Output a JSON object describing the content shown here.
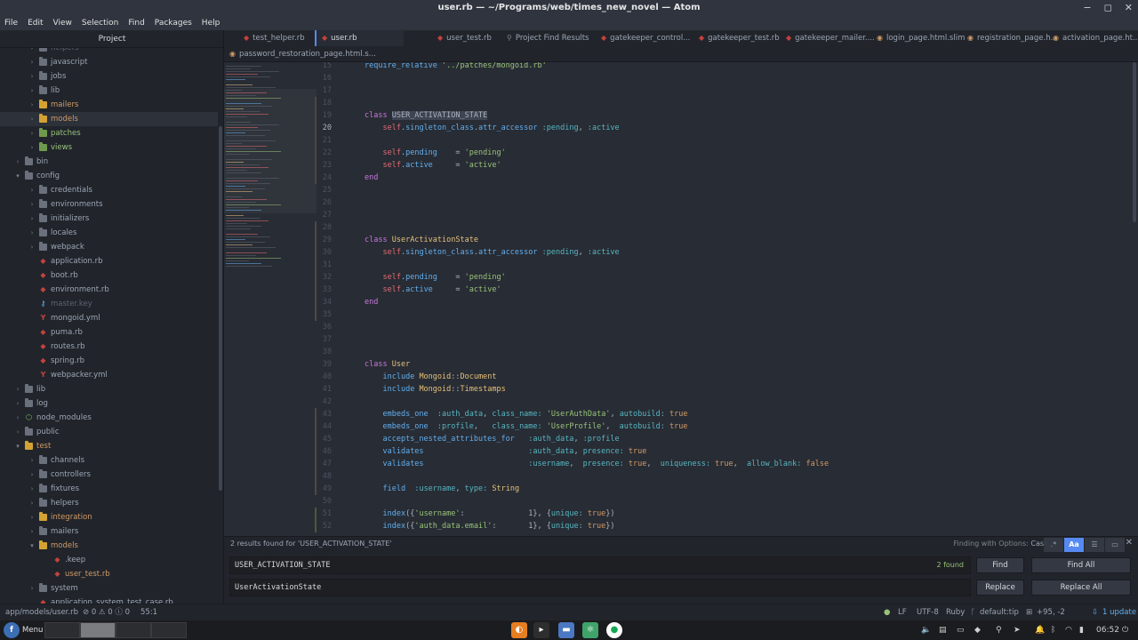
{
  "window": {
    "title": "user.rb — ~/Programs/web/times_new_novel — Atom",
    "controls": [
      "−",
      "◻",
      "✕"
    ]
  },
  "menu": [
    "File",
    "Edit",
    "View",
    "Selection",
    "Find",
    "Packages",
    "Help"
  ],
  "tree": {
    "header": "Project",
    "rows": [
      {
        "label": "helpers",
        "type": "folder",
        "indent": 1,
        "expanded": false,
        "color": "muted"
      },
      {
        "label": "javascript",
        "type": "folder",
        "indent": 1,
        "expanded": false
      },
      {
        "label": "jobs",
        "type": "folder",
        "indent": 1,
        "expanded": false
      },
      {
        "label": "lib",
        "type": "folder",
        "indent": 1,
        "expanded": false
      },
      {
        "label": "mailers",
        "type": "folder",
        "indent": 1,
        "expanded": false,
        "color": "yellow"
      },
      {
        "label": "models",
        "type": "folder",
        "indent": 1,
        "expanded": false,
        "color": "yellow",
        "selected": true
      },
      {
        "label": "patches",
        "type": "folder",
        "indent": 1,
        "expanded": false,
        "color": "green"
      },
      {
        "label": "views",
        "type": "folder",
        "indent": 1,
        "expanded": false,
        "color": "green"
      },
      {
        "label": "bin",
        "type": "folder",
        "indent": 0,
        "expanded": false
      },
      {
        "label": "config",
        "type": "folder",
        "indent": 0,
        "expanded": true
      },
      {
        "label": "credentials",
        "type": "folder",
        "indent": 1,
        "expanded": false
      },
      {
        "label": "environments",
        "type": "folder",
        "indent": 1,
        "expanded": false
      },
      {
        "label": "initializers",
        "type": "folder",
        "indent": 1,
        "expanded": false
      },
      {
        "label": "locales",
        "type": "folder",
        "indent": 1,
        "expanded": false
      },
      {
        "label": "webpack",
        "type": "folder",
        "indent": 1,
        "expanded": false
      },
      {
        "label": "application.rb",
        "type": "ruby",
        "indent": 1
      },
      {
        "label": "boot.rb",
        "type": "ruby",
        "indent": 1
      },
      {
        "label": "environment.rb",
        "type": "ruby",
        "indent": 1
      },
      {
        "label": "master.key",
        "type": "key",
        "indent": 1,
        "color": "muted"
      },
      {
        "label": "mongoid.yml",
        "type": "yml",
        "indent": 1
      },
      {
        "label": "puma.rb",
        "type": "ruby",
        "indent": 1
      },
      {
        "label": "routes.rb",
        "type": "ruby",
        "indent": 1
      },
      {
        "label": "spring.rb",
        "type": "ruby",
        "indent": 1
      },
      {
        "label": "webpacker.yml",
        "type": "yml",
        "indent": 1
      },
      {
        "label": "lib",
        "type": "folder",
        "indent": 0,
        "expanded": false
      },
      {
        "label": "log",
        "type": "folder",
        "indent": 0,
        "expanded": false
      },
      {
        "label": "node_modules",
        "type": "node",
        "indent": 0,
        "expanded": false
      },
      {
        "label": "public",
        "type": "folder",
        "indent": 0,
        "expanded": false
      },
      {
        "label": "test",
        "type": "folder",
        "indent": 0,
        "expanded": true,
        "color": "yellow"
      },
      {
        "label": "channels",
        "type": "folder",
        "indent": 1,
        "expanded": false
      },
      {
        "label": "controllers",
        "type": "folder",
        "indent": 1,
        "expanded": false
      },
      {
        "label": "fixtures",
        "type": "folder",
        "indent": 1,
        "expanded": false
      },
      {
        "label": "helpers",
        "type": "folder",
        "indent": 1,
        "expanded": false
      },
      {
        "label": "integration",
        "type": "folder",
        "indent": 1,
        "expanded": false,
        "color": "yellow"
      },
      {
        "label": "mailers",
        "type": "folder",
        "indent": 1,
        "expanded": false
      },
      {
        "label": "models",
        "type": "folder",
        "indent": 1,
        "expanded": true,
        "color": "yellow"
      },
      {
        "label": ".keep",
        "type": "ruby",
        "indent": 2
      },
      {
        "label": "user_test.rb",
        "type": "ruby",
        "indent": 2,
        "color": "yellow"
      },
      {
        "label": "system",
        "type": "folder",
        "indent": 1,
        "expanded": false
      },
      {
        "label": "application_system_test_case.rb",
        "type": "ruby",
        "indent": 1
      }
    ]
  },
  "tabs": [
    {
      "label": "test_helper.rb",
      "icon": "ruby"
    },
    {
      "label": "user.rb",
      "icon": "ruby",
      "active": true
    },
    {
      "label": "user_test.rb",
      "icon": "ruby"
    },
    {
      "label": "Project Find Results",
      "icon": "search"
    },
    {
      "label": "gatekeeper_control...",
      "icon": "ruby"
    },
    {
      "label": "gatekeeper_test.rb",
      "icon": "ruby"
    },
    {
      "label": "gatekeeper_mailer....",
      "icon": "ruby"
    },
    {
      "label": "login_page.html.slim",
      "icon": "slim"
    },
    {
      "label": "registration_page.h...",
      "icon": "slim"
    },
    {
      "label": "activation_page.ht...",
      "icon": "slim"
    },
    {
      "label": "password_restoration_page.html.s...",
      "icon": "slim"
    }
  ],
  "editor": {
    "first_line": 15,
    "current_line": 20,
    "lines": [
      [
        [
          "meth",
          "require_relative"
        ],
        [
          "txt",
          " "
        ],
        [
          "str",
          "'../patches/mongoid.rb'"
        ]
      ],
      [],
      [],
      [],
      [
        [
          "kw",
          "class"
        ],
        [
          "txt",
          " "
        ],
        [
          "hl",
          "USER_ACTIVATION_STATE"
        ]
      ],
      [
        [
          "txt",
          "    "
        ],
        [
          "self",
          "self"
        ],
        [
          "txt",
          "."
        ],
        [
          "meth",
          "singleton_class"
        ],
        [
          "txt",
          "."
        ],
        [
          "meth",
          "attr_accessor"
        ],
        [
          "txt",
          " "
        ],
        [
          "sym",
          ":pending"
        ],
        [
          "txt",
          ", "
        ],
        [
          "sym",
          ":active"
        ]
      ],
      [],
      [
        [
          "txt",
          "    "
        ],
        [
          "self",
          "self"
        ],
        [
          "txt",
          "."
        ],
        [
          "meth",
          "pending"
        ],
        [
          "txt",
          "    = "
        ],
        [
          "str",
          "'pending'"
        ]
      ],
      [
        [
          "txt",
          "    "
        ],
        [
          "self",
          "self"
        ],
        [
          "txt",
          "."
        ],
        [
          "meth",
          "active"
        ],
        [
          "txt",
          "     = "
        ],
        [
          "str",
          "'active'"
        ]
      ],
      [
        [
          "kw",
          "end"
        ]
      ],
      [],
      [],
      [],
      [],
      [
        [
          "kw",
          "class"
        ],
        [
          "txt",
          " "
        ],
        [
          "cls",
          "UserActivationState"
        ]
      ],
      [
        [
          "txt",
          "    "
        ],
        [
          "self",
          "self"
        ],
        [
          "txt",
          "."
        ],
        [
          "meth",
          "singleton_class"
        ],
        [
          "txt",
          "."
        ],
        [
          "meth",
          "attr_accessor"
        ],
        [
          "txt",
          " "
        ],
        [
          "sym",
          ":pending"
        ],
        [
          "txt",
          ", "
        ],
        [
          "sym",
          ":active"
        ]
      ],
      [],
      [
        [
          "txt",
          "    "
        ],
        [
          "self",
          "self"
        ],
        [
          "txt",
          "."
        ],
        [
          "meth",
          "pending"
        ],
        [
          "txt",
          "    = "
        ],
        [
          "str",
          "'pending'"
        ]
      ],
      [
        [
          "txt",
          "    "
        ],
        [
          "self",
          "self"
        ],
        [
          "txt",
          "."
        ],
        [
          "meth",
          "active"
        ],
        [
          "txt",
          "     = "
        ],
        [
          "str",
          "'active'"
        ]
      ],
      [
        [
          "kw",
          "end"
        ]
      ],
      [],
      [],
      [],
      [],
      [
        [
          "kw",
          "class"
        ],
        [
          "txt",
          " "
        ],
        [
          "cls",
          "User"
        ]
      ],
      [
        [
          "txt",
          "    "
        ],
        [
          "meth",
          "include"
        ],
        [
          "txt",
          " "
        ],
        [
          "cls",
          "Mongoid"
        ],
        [
          "txt",
          "::"
        ],
        [
          "cls",
          "Document"
        ]
      ],
      [
        [
          "txt",
          "    "
        ],
        [
          "meth",
          "include"
        ],
        [
          "txt",
          " "
        ],
        [
          "cls",
          "Mongoid"
        ],
        [
          "txt",
          "::"
        ],
        [
          "cls",
          "Timestamps"
        ]
      ],
      [],
      [
        [
          "txt",
          "    "
        ],
        [
          "meth",
          "embeds_one"
        ],
        [
          "txt",
          "  "
        ],
        [
          "sym",
          ":auth_data"
        ],
        [
          "txt",
          ", "
        ],
        [
          "sym",
          "class_name:"
        ],
        [
          "txt",
          " "
        ],
        [
          "str",
          "'UserAuthData'"
        ],
        [
          "txt",
          ", "
        ],
        [
          "sym",
          "autobuild:"
        ],
        [
          "txt",
          " "
        ],
        [
          "const",
          "true"
        ]
      ],
      [
        [
          "txt",
          "    "
        ],
        [
          "meth",
          "embeds_one"
        ],
        [
          "txt",
          "  "
        ],
        [
          "sym",
          ":profile"
        ],
        [
          "txt",
          ",   "
        ],
        [
          "sym",
          "class_name:"
        ],
        [
          "txt",
          " "
        ],
        [
          "str",
          "'UserProfile'"
        ],
        [
          "txt",
          ",  "
        ],
        [
          "sym",
          "autobuild:"
        ],
        [
          "txt",
          " "
        ],
        [
          "const",
          "true"
        ]
      ],
      [
        [
          "txt",
          "    "
        ],
        [
          "meth",
          "accepts_nested_attributes_for"
        ],
        [
          "txt",
          "   "
        ],
        [
          "sym",
          ":auth_data"
        ],
        [
          "txt",
          ", "
        ],
        [
          "sym",
          ":profile"
        ]
      ],
      [
        [
          "txt",
          "    "
        ],
        [
          "meth",
          "validates"
        ],
        [
          "txt",
          "                       "
        ],
        [
          "sym",
          ":auth_data"
        ],
        [
          "txt",
          ", "
        ],
        [
          "sym",
          "presence:"
        ],
        [
          "txt",
          " "
        ],
        [
          "const",
          "true"
        ]
      ],
      [
        [
          "txt",
          "    "
        ],
        [
          "meth",
          "validates"
        ],
        [
          "txt",
          "                       "
        ],
        [
          "sym",
          ":username"
        ],
        [
          "txt",
          ",  "
        ],
        [
          "sym",
          "presence:"
        ],
        [
          "txt",
          " "
        ],
        [
          "const",
          "true"
        ],
        [
          "txt",
          ",  "
        ],
        [
          "sym",
          "uniqueness:"
        ],
        [
          "txt",
          " "
        ],
        [
          "const",
          "true"
        ],
        [
          "txt",
          ",  "
        ],
        [
          "sym",
          "allow_blank:"
        ],
        [
          "txt",
          " "
        ],
        [
          "const",
          "false"
        ]
      ],
      [],
      [
        [
          "txt",
          "    "
        ],
        [
          "meth",
          "field"
        ],
        [
          "txt",
          "  "
        ],
        [
          "sym",
          ":username"
        ],
        [
          "txt",
          ", "
        ],
        [
          "sym",
          "type:"
        ],
        [
          "txt",
          " "
        ],
        [
          "cls",
          "String"
        ]
      ],
      [],
      [
        [
          "txt",
          "    "
        ],
        [
          "meth",
          "index"
        ],
        [
          "txt",
          "({"
        ],
        [
          "str",
          "'username'"
        ],
        [
          "txt",
          ":              1}, {"
        ],
        [
          "sym",
          "unique:"
        ],
        [
          "txt",
          " "
        ],
        [
          "const",
          "true"
        ],
        [
          "txt",
          "})"
        ]
      ],
      [
        [
          "txt",
          "    "
        ],
        [
          "meth",
          "index"
        ],
        [
          "txt",
          "({"
        ],
        [
          "str",
          "'auth_data.email'"
        ],
        [
          "txt",
          ":       1}, {"
        ],
        [
          "sym",
          "unique:"
        ],
        [
          "txt",
          " "
        ],
        [
          "const",
          "true"
        ],
        [
          "txt",
          "})"
        ]
      ]
    ]
  },
  "find": {
    "description": "2 results found for 'USER_ACTIVATION_STATE'",
    "options_label": "Finding with Options:",
    "options_value": "Case Sensitive",
    "option_buttons": [
      ".*",
      "Aa",
      "☰",
      "▭"
    ],
    "find_value": "USER_ACTIVATION_STATE",
    "count": "2 found",
    "replace_value": "UserActivationState",
    "buttons": {
      "find": "Find",
      "find_all": "Find All",
      "replace": "Replace",
      "replace_all": "Replace All"
    }
  },
  "status": {
    "path": "app/models/user.rb",
    "diagnostics": "⊘ 0  ⚠ 0  ⓘ 0",
    "cursor": "55:1",
    "line_ending": "LF",
    "encoding": "UTF-8",
    "grammar": "Ruby",
    "branch": "default:tip",
    "diff": "+95, -2",
    "update": "1 update"
  },
  "taskbar": {
    "menu_label": "Menu",
    "time": "06:52"
  },
  "colors": {
    "accent": "#568af2",
    "editor_bg": "#282c34",
    "panel_bg": "#21252b"
  }
}
